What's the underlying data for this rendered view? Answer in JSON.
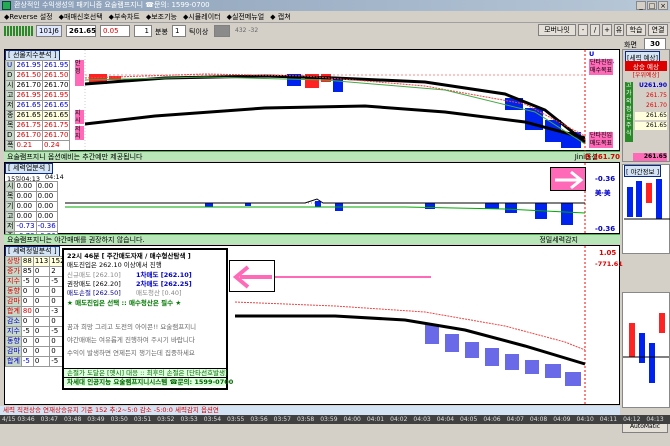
{
  "window": {
    "title": "환상적인 수익생성의 패키니즘 요술램프지니 ☎문의: 1599-0700",
    "controls": [
      "_",
      "□",
      "×"
    ]
  },
  "menu": [
    "◆Reverse 설정",
    "◆매매신호선택",
    "◆부속차트",
    "◆보조기능",
    "◆시뮬레이터",
    "◆실전메뉴얼",
    "◆ 캡쳐"
  ],
  "toolbar": {
    "code": "101J6",
    "price": "261.65",
    "change": "0.05",
    "interval": "1",
    "unit1": "분봉",
    "count": "1",
    "unit2": "틱이상",
    "extra": "432 -32",
    "right_buttons": [
      "모버나잇",
      "-",
      "/",
      "+",
      "유",
      "학습",
      "연결"
    ],
    "screen_label": "화면",
    "screen_value": "30"
  },
  "panel1": {
    "title": "[ 선물지수분석 ]",
    "rows": [
      {
        "label": "U",
        "v1": "261.95",
        "v2": "261.95"
      },
      {
        "label": "D",
        "v1": "261.50",
        "v2": "261.50"
      },
      {
        "label": "시",
        "v1": "261.70",
        "v2": "261.70"
      },
      {
        "label": "고",
        "v1": "261.95",
        "v2": "261.95"
      },
      {
        "label": "저",
        "v1": "261.65",
        "v2": "261.65"
      },
      {
        "label": "종",
        "v1": "261.65",
        "v2": "261.65"
      },
      {
        "label": "목",
        "v1": "261.75",
        "v2": "261.75"
      },
      {
        "label": "D",
        "v1": "261.70",
        "v2": "261.70"
      },
      {
        "label": "폭",
        "v1": "0.21",
        "v2": "0.24"
      }
    ],
    "side_labels": [
      "안정",
      "지시",
      "저지"
    ],
    "right_labels": {
      "u": "U 261.95",
      "u_note": "단타진입",
      "u_note2": "매수목표",
      "d": "D 261.70",
      "d_note": "단타진입",
      "d_note2": "매도목표"
    },
    "status": "요술램프지니 옵션예비는 추간예만 제공됩니다",
    "status_right": "Jini옵션"
  },
  "panel2": {
    "title": "[ 세력업분석 ]",
    "time1": "15일04:13",
    "time2": "04:14",
    "rows": [
      {
        "label": "시",
        "v1": "0.00",
        "v2": "0.00"
      },
      {
        "label": "목",
        "v1": "0.00",
        "v2": "0.00"
      },
      {
        "label": "기",
        "v1": "0.00",
        "v2": "0.00"
      },
      {
        "label": "고",
        "v1": "0.00",
        "v2": "0.00"
      },
      {
        "label": "저",
        "v1": "-0.73",
        "v2": "-0.36"
      },
      {
        "label": "종",
        "v1": "-0.73",
        "v2": "-0.36"
      },
      {
        "label": "",
        "v1": "-0.27",
        "v2": "-0.27"
      }
    ],
    "right_top": "-0.36",
    "right_note": "美·美",
    "right_bottom": "-0.36",
    "status": "요술램프지니는 야간매매를 권장하지 않습니다.",
    "status_right": "정밀세력감지"
  },
  "panel3": {
    "title": "[ 세력정밀분석 ]",
    "header": {
      "label": "상방",
      "v1": "88",
      "v2": "113",
      "v3": "152"
    },
    "rows": [
      {
        "label": "증가",
        "v1": "85",
        "v2": "0",
        "v3": "2"
      },
      {
        "label": "지수",
        "v1": "-5",
        "v2": "0",
        "v3": "-5"
      },
      {
        "label": "동향",
        "v1": "0",
        "v2": "0",
        "v3": "0"
      },
      {
        "label": "감마",
        "v1": "0",
        "v2": "0",
        "v3": "0"
      },
      {
        "label": "합계",
        "v1": "80",
        "v2": "0",
        "v3": "-3"
      },
      {
        "label": "감소",
        "v1": "0",
        "v2": "0",
        "v3": "0"
      },
      {
        "label": "지수",
        "v1": "-5",
        "v2": "0",
        "v3": "-5"
      },
      {
        "label": "동향",
        "v1": "0",
        "v2": "0",
        "v3": "0"
      },
      {
        "label": "감마",
        "v1": "0",
        "v2": "0",
        "v3": "0"
      },
      {
        "label": "합계",
        "v1": "-5",
        "v2": "0",
        "v3": "-5"
      }
    ],
    "right_top": "1.05",
    "right_bottom": "-771.61"
  },
  "info": {
    "line1": "22시 46분 [ 주간매도자재 / 매수형산탐색 ]",
    "line2": "매도진입은 262.10 이상에서 진행",
    "line3a": "신규매도 [262.10]",
    "line3b": "1차매도 [262.10]",
    "line4a": "권장매도 [262.20]",
    "line4b": "2차매도 [262.25]",
    "line5a": "매도손절 [262.50]",
    "line5b": "매도청산 [0.40]",
    "line6": "★ 매도진입은 선택 :: 매수청산은 필수 ★",
    "line7": "꿈과 희망 그리고 도전의 아이콘!! 요술램프지니",
    "line8": "야간매매는 여유롭게 진행하여 주시기 바랍니다",
    "line9": "수익이 발생하면 연제든지 챙기는데 집중하세요",
    "line10": "손절가 도달은 [옛시] 대응 :: 최후의 손절은 [단타선호발생]",
    "line11": "차세대 인공지능 요술램프지니시스템 ☎문의: 1599-0700"
  },
  "right_panel": {
    "title": "[세력 예상]",
    "label1": "상승 예상",
    "label2": "[우위예상]",
    "u": "U261.90",
    "v1": "261.75",
    "v2": "261.70",
    "v3": "261.65",
    "v4": "261.65",
    "labels": [
      "고",
      "가",
      "외",
      "정",
      "관",
      "주",
      "식"
    ],
    "bottom_value": "261.65",
    "second_title": "[ 야간정보 ]",
    "auto_button": "AutoMatic"
  },
  "bottom_status": "세력 직전상승 연재상승유지 기준 152 추:2~5:0        감소 -5:0:0                                                                     세력감지        옵션연",
  "times": [
    "4/15 03:46",
    "03:47",
    "03:48",
    "03:49",
    "03:50",
    "03:51",
    "03:52",
    "03:53",
    "03:54",
    "03:55",
    "03:56",
    "03:57",
    "03:58",
    "03:59",
    "04:00",
    "04:01",
    "04:02",
    "04:03",
    "04:04",
    "04:05",
    "04:06",
    "04:07",
    "04:08",
    "04:09",
    "04:10",
    "04:11",
    "04:12",
    "04:13",
    "04:14"
  ],
  "colors": {
    "accent": "#ff6ab8",
    "status_green": "#b8e6b8",
    "candle_blue": "#0020e0",
    "candle_red": "#ff2020"
  }
}
